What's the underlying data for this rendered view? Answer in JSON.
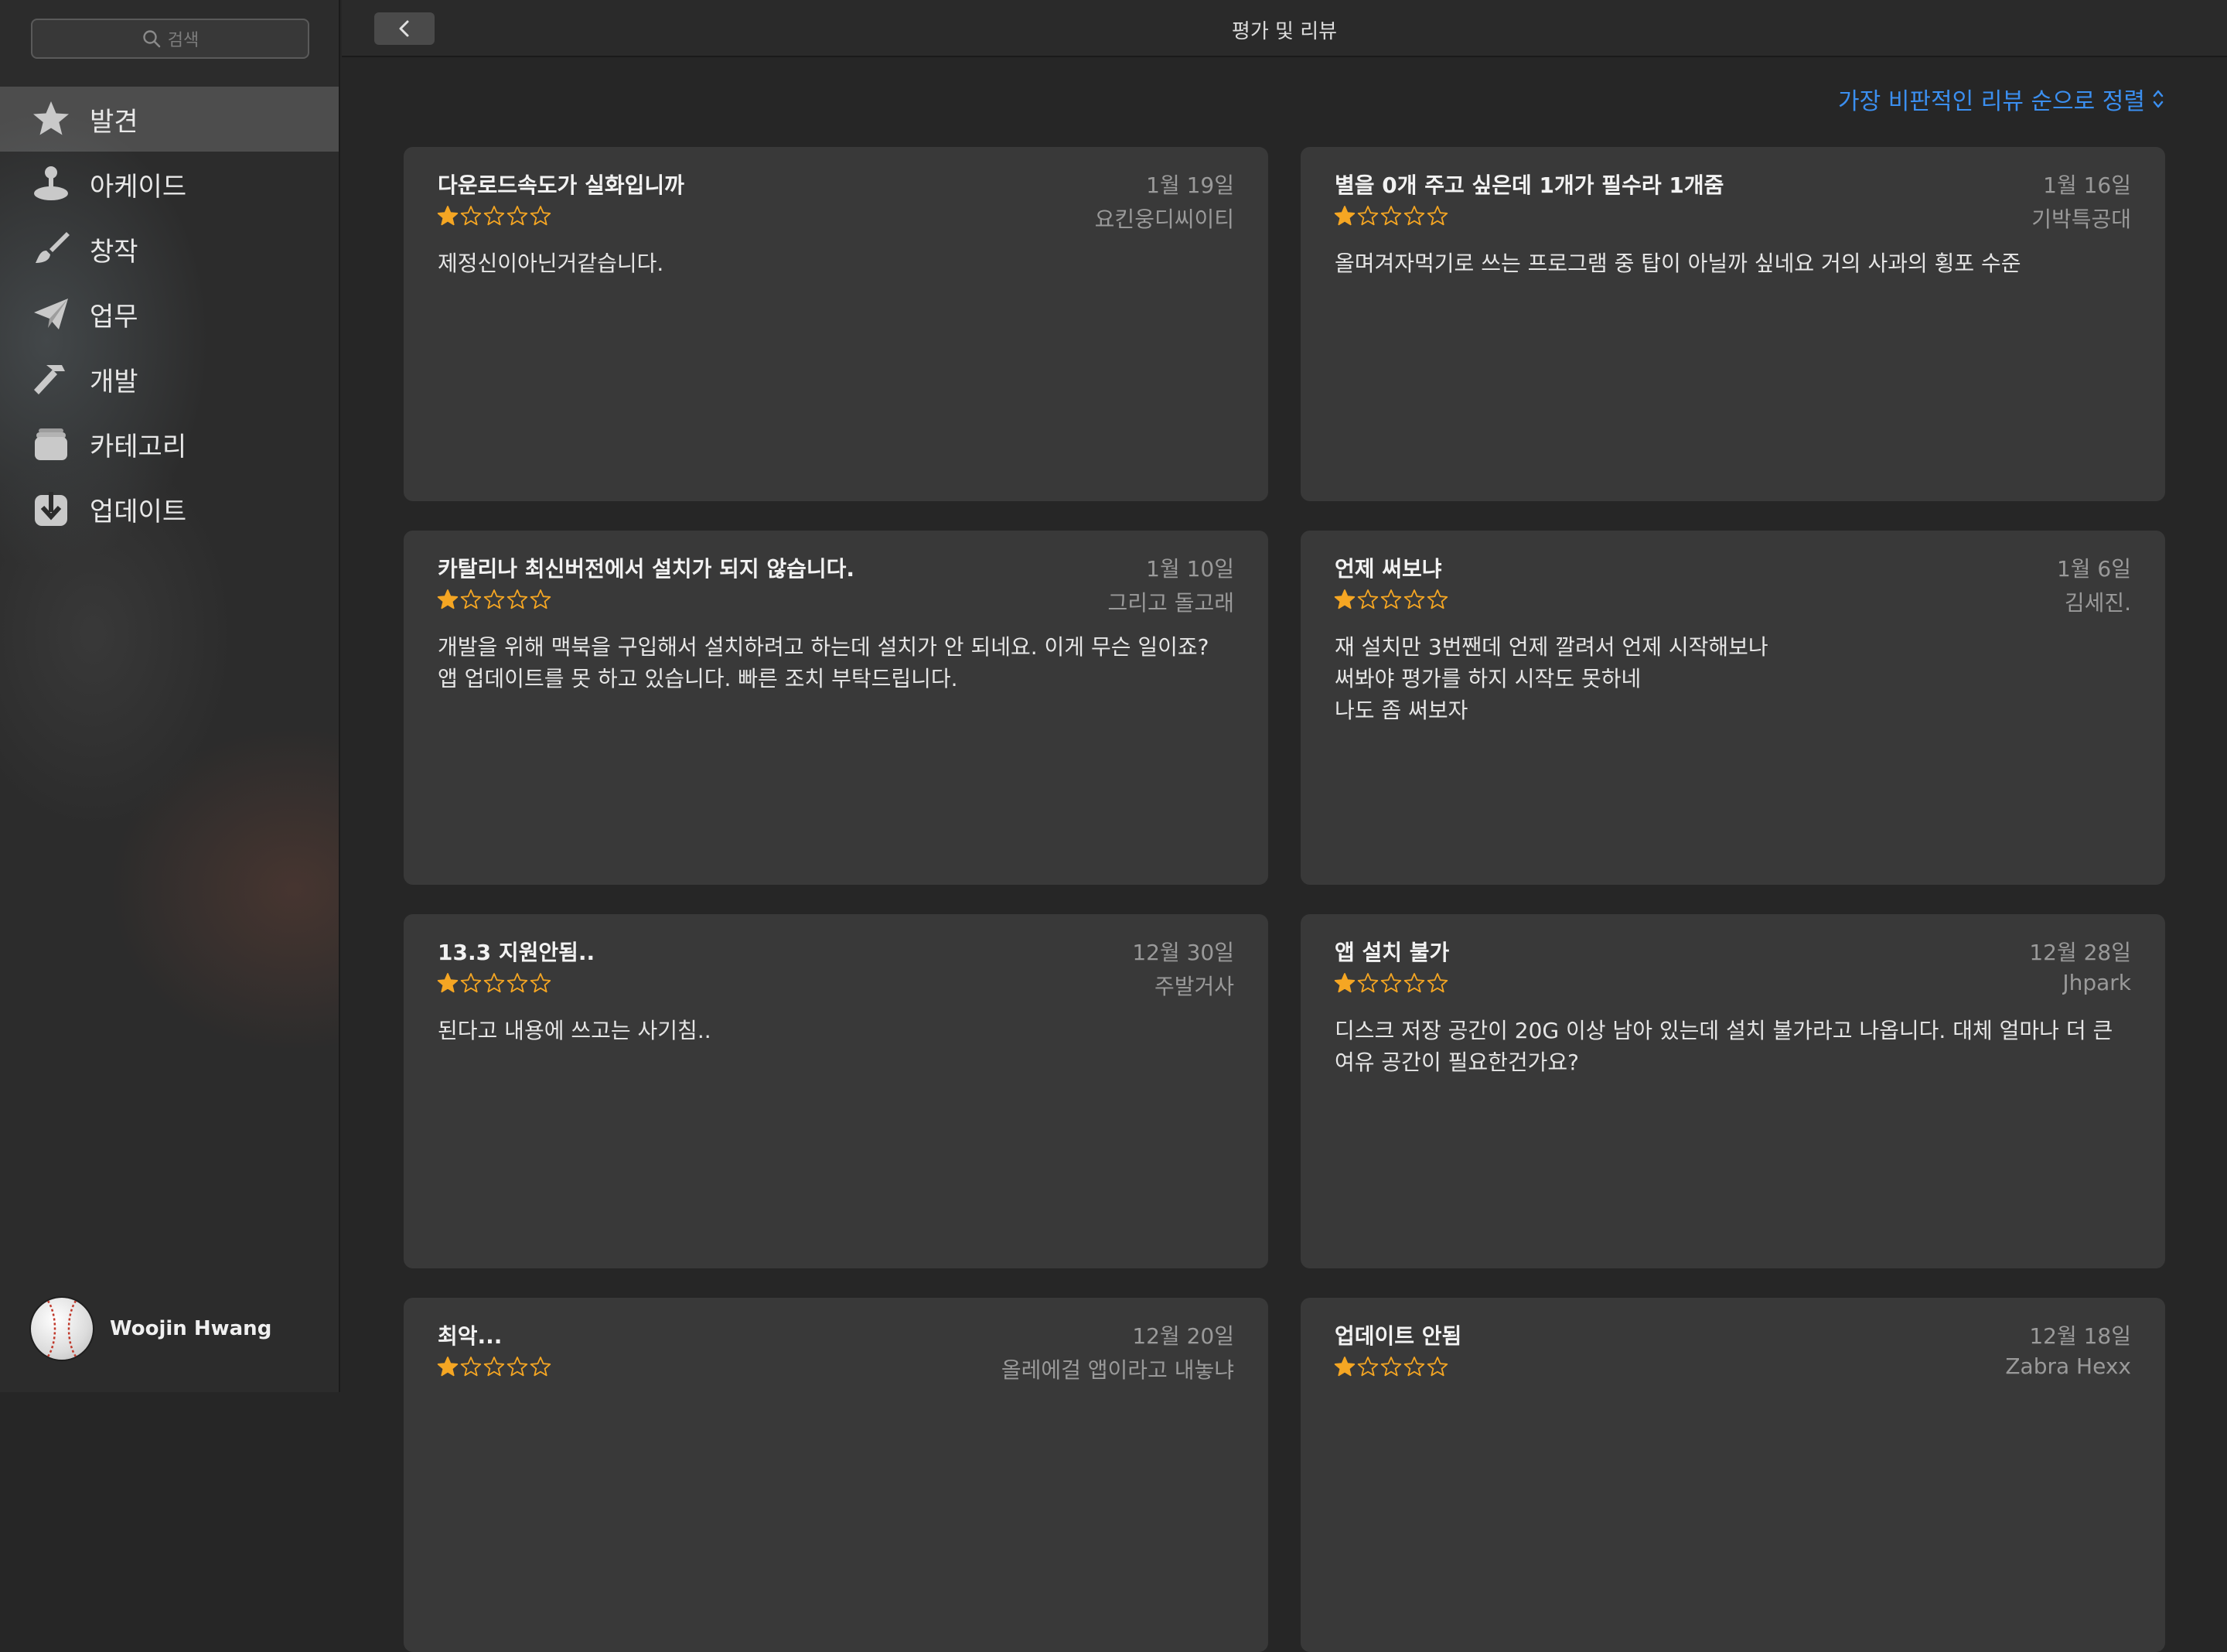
{
  "sidebar": {
    "search_placeholder": "검색",
    "items": [
      {
        "label": "발견",
        "icon": "star-icon",
        "active": true
      },
      {
        "label": "아케이드",
        "icon": "joystick-icon",
        "active": false
      },
      {
        "label": "창작",
        "icon": "paintbrush-icon",
        "active": false
      },
      {
        "label": "업무",
        "icon": "paper-plane-icon",
        "active": false
      },
      {
        "label": "개발",
        "icon": "hammer-icon",
        "active": false
      },
      {
        "label": "카테고리",
        "icon": "stack-icon",
        "active": false
      },
      {
        "label": "업데이트",
        "icon": "download-icon",
        "active": false
      }
    ],
    "user_name": "Woojin Hwang"
  },
  "header": {
    "title": "평가 및 리뷰",
    "sort_label": "가장 비판적인 리뷰 순으로 정렬"
  },
  "colors": {
    "accent": "#3b8ff0",
    "star": "#f5a623"
  },
  "reviews": [
    {
      "title": "다운로드속도가 실화입니까",
      "date": "1월 19일",
      "author": "요킨웅디씨이티",
      "rating": 1,
      "body": "제정신이아닌거같습니다."
    },
    {
      "title": "별을 0개 주고 싶은데 1개가 필수라 1개줌",
      "date": "1월 16일",
      "author": "기박특공대",
      "rating": 1,
      "body": "올며겨자먹기로 쓰는 프로그램 중 탑이 아닐까 싶네요 거의 사과의 횡포 수준"
    },
    {
      "title": "카탈리나 최신버전에서 설치가 되지 않습니다.",
      "date": "1월 10일",
      "author": "그리고 돌고래",
      "rating": 1,
      "body": "개발을 위해 맥북을 구입해서 설치하려고 하는데 설치가 안 되네요. 이게 무슨 일이죠?\n앱 업데이트를 못 하고 있습니다. 빠른 조치 부탁드립니다."
    },
    {
      "title": "언제 써보냐",
      "date": "1월 6일",
      "author": "김세진.",
      "rating": 1,
      "body": "재 설치만 3번짼데 언제 깔려서 언제 시작해보나\n써봐야 평가를 하지 시작도 못하네\n나도 좀 써보자"
    },
    {
      "title": "13.3 지원안됨..",
      "date": "12월 30일",
      "author": "주발거사",
      "rating": 1,
      "body": "된다고 내용에 쓰고는 사기침.."
    },
    {
      "title": "앱 설치 불가",
      "date": "12월 28일",
      "author": "Jhpark",
      "rating": 1,
      "body": "디스크 저장 공간이 20G 이상 남아 있는데 설치 불가라고 나옵니다. 대체 얼마나 더 큰\n여유 공간이 필요한건가요?"
    },
    {
      "title": "최악...",
      "date": "12월 20일",
      "author": "올레에걸 앱이라고 내놓냐",
      "rating": 1,
      "body": ""
    },
    {
      "title": "업데이트 안됨",
      "date": "12월 18일",
      "author": "Zabra Hexx",
      "rating": 1,
      "body": ""
    }
  ]
}
